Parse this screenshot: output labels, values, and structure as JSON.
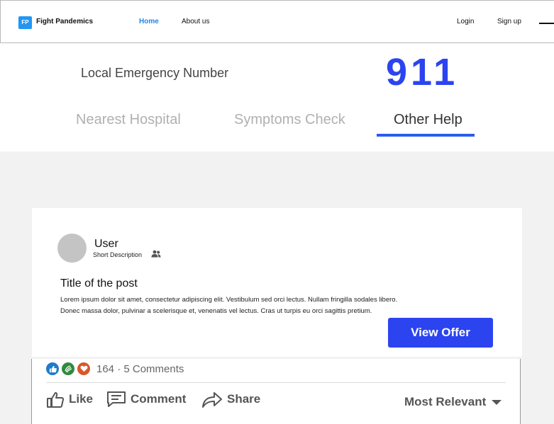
{
  "nav": {
    "logo_badge": "FP",
    "logo_text": "Fight Pandemics",
    "links": [
      "Home",
      "About us"
    ],
    "login": "Login",
    "signup": "Sign up"
  },
  "emergency": {
    "label": "Local Emergency Number",
    "number": "911"
  },
  "tabs": [
    "Nearest Hospital",
    "Symptoms Check",
    "Other Help"
  ],
  "active_tab": "Other Help",
  "post": {
    "user_name": "User",
    "short_description": "Short Description",
    "title": "Title of the post",
    "body_line1": "Lorem ipsum dolor sit amet, consectetur adipiscing elit. Vestibulum sed orci lectus. Nullam fringilla sodales libero.",
    "body_line2": "Donec massa dolor, pulvinar a scelerisque et, venenatis vel lectus. Cras ut turpis eu orci sagittis pretium.",
    "cta": "View Offer"
  },
  "social": {
    "reaction_summary": "164 · 5 Comments",
    "actions": [
      "Like",
      "Comment",
      "Share"
    ],
    "sort": "Most Relevant"
  },
  "colors": {
    "accent": "#2b44f0",
    "link_active": "#1e88e5",
    "tab_underline": "#2b5cf0"
  }
}
